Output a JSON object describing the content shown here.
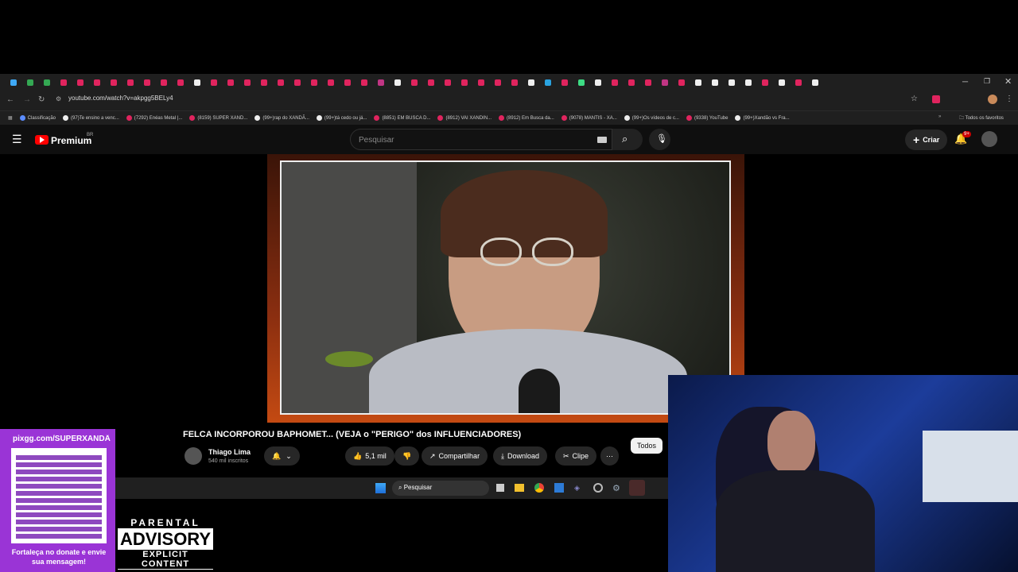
{
  "browser": {
    "url": "youtube.com/watch?v=akpgg5BELy4",
    "bookmarks": [
      "Classificação",
      "(97)Te ensino a venc...",
      "(7292) Enéas Metal |...",
      "(8159) SUPER XAND...",
      "(99+)rap do XANDÃ...",
      "(99+)tá cedo ou já...",
      "(8851) EM BUSCA D...",
      "(8912) VAI XANDIN...",
      "(8912) Em Busca da...",
      "(9078) MANTIS - XA...",
      "(99+)Os vídeos de c...",
      "(9338) YouTube",
      "(99+)Xandão vs Fra..."
    ],
    "all_favorites": "Todos os favoritos"
  },
  "youtube": {
    "logo": "Premium",
    "country": "BR",
    "search_placeholder": "Pesquisar",
    "create_label": "Criar",
    "notifications": "9+"
  },
  "video": {
    "title": "FELCA INCORPOROU BAPHOMET... (VEJA o \"PERIGO\" dos INFLUENCIADORES)",
    "channel": "Thiago Lima",
    "subscribers": "540 mil inscritos",
    "likes": "5,1 mil",
    "share": "Compartilhar",
    "download": "Download",
    "clip": "Clipe",
    "filter": "Todos"
  },
  "taskbar": {
    "search": "Pesquisar"
  },
  "overlay": {
    "donate_url": "pixgg.com/SUPERXANDÃ",
    "donate_text": "Fortaleça no donate e envie sua mensagem!",
    "advisory": [
      "PARENTAL",
      "ADVISORY",
      "EXPLICIT CONTENT"
    ]
  },
  "colors": {
    "yt_red": "#ff0000",
    "tab_pink": "#e0245e",
    "qr_purple": "#9a34d6"
  }
}
